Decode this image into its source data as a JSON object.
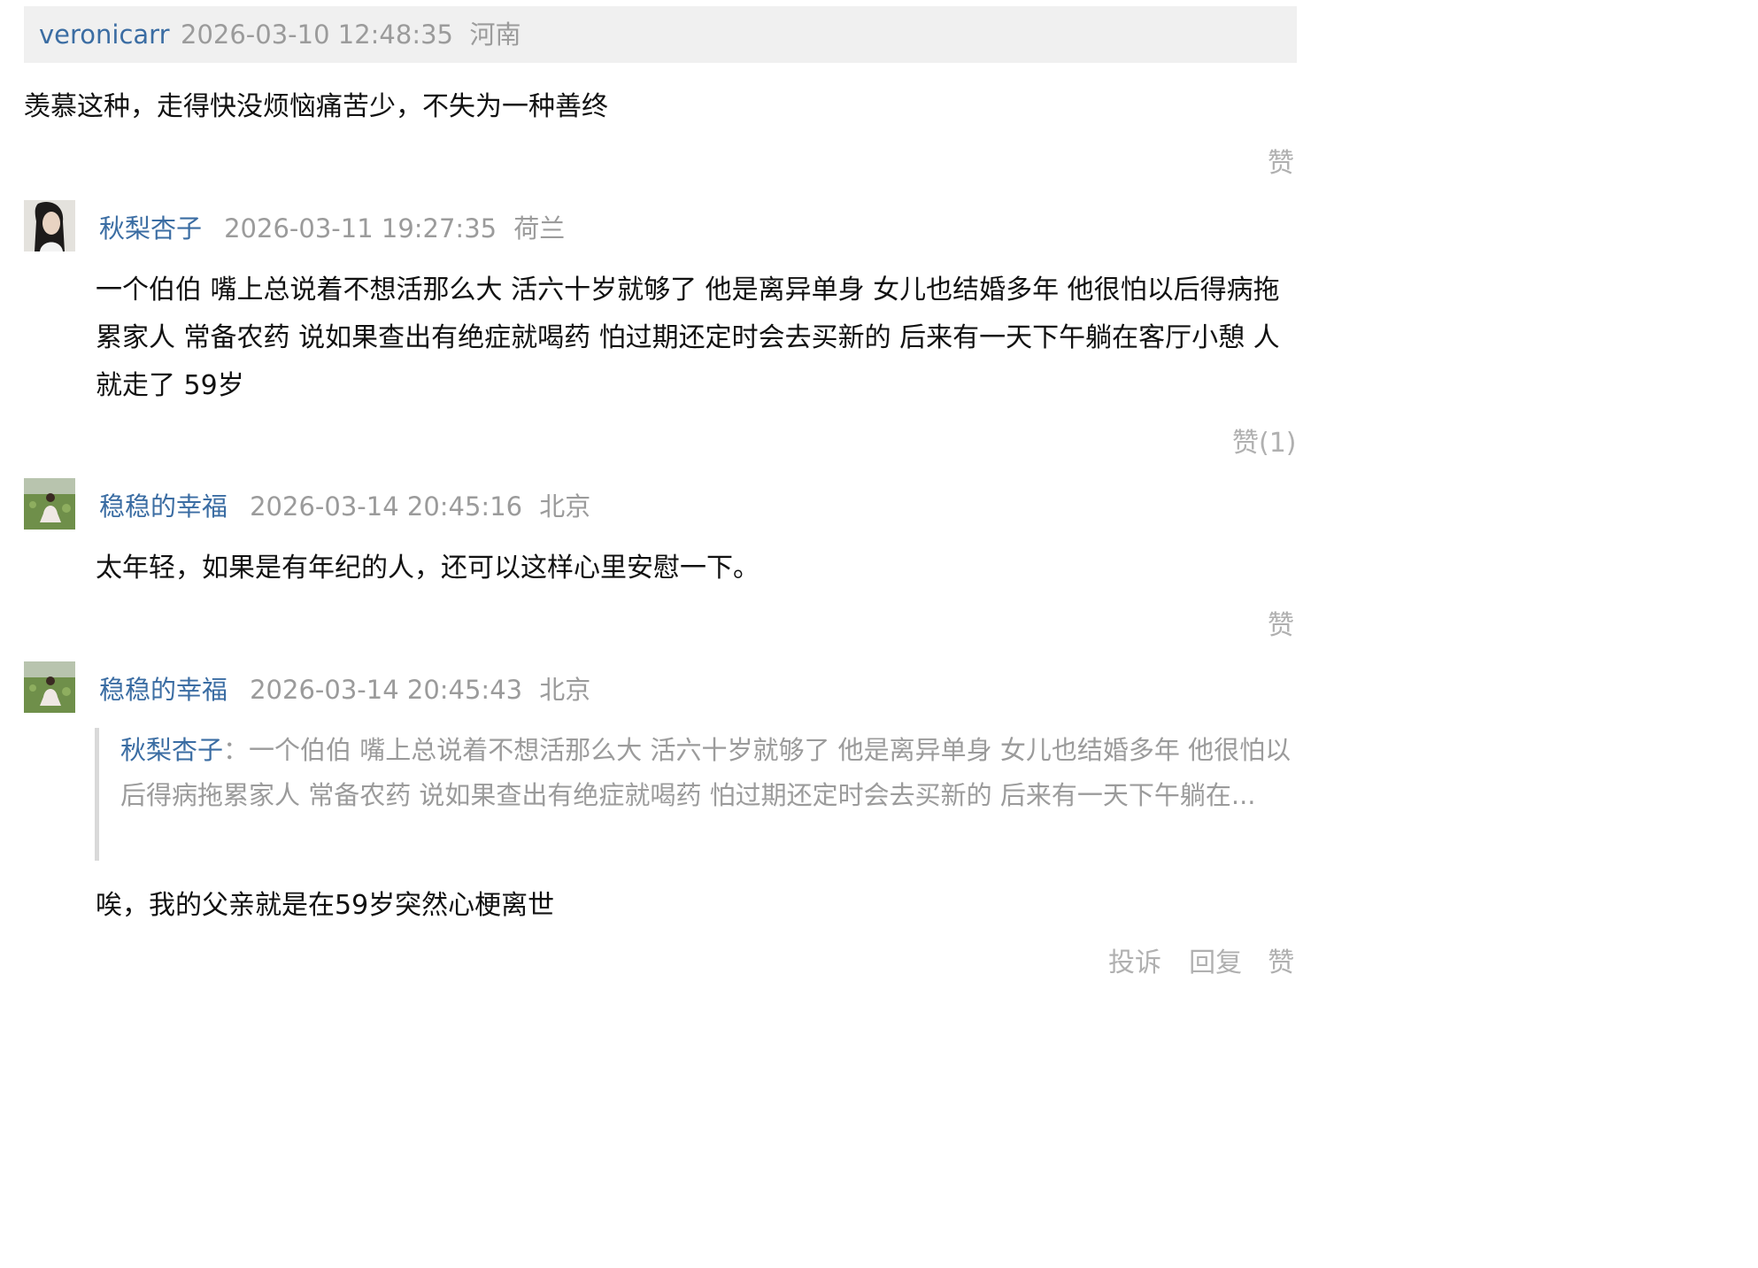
{
  "comments": [
    {
      "username": "veronicarr",
      "datetime": "2026-03-10 12:48:35",
      "location": "河南",
      "text": "羡慕这种，走得快没烦恼痛苦少，不失为一种善终",
      "like_label": "赞"
    },
    {
      "username": "秋梨杏子",
      "datetime": "2026-03-11 19:27:35",
      "location": "荷兰",
      "text": "一个伯伯 嘴上总说着不想活那么大 活六十岁就够了 他是离异单身 女儿也结婚多年 他很怕以后得病拖累家人 常备农药 说如果查出有绝症就喝药 怕过期还定时会去买新的 后来有一天下午躺在客厅小憩 人就走了 59岁",
      "like_label": "赞(1)",
      "avatar_icon": "user-avatar-icon"
    },
    {
      "username": "稳稳的幸福",
      "datetime": "2026-03-14 20:45:16",
      "location": "北京",
      "text": "太年轻，如果是有年纪的人，还可以这样心里安慰一下。",
      "like_label": "赞",
      "avatar_icon": "user-avatar-icon"
    },
    {
      "username": "稳稳的幸福",
      "datetime": "2026-03-14 20:45:43",
      "location": "北京",
      "quote": {
        "author": "秋梨杏子",
        "separator": "：",
        "text": "一个伯伯 嘴上总说着不想活那么大 活六十岁就够了 他是离异单身 女儿也结婚多年 他很怕以后得病拖累家人 常备农药 说如果查出有绝症就喝药 怕过期还定时会去买新的 后来有一天下午躺在..."
      },
      "text": "唉，我的父亲就是在59岁突然心梗离世",
      "report_label": "投诉",
      "reply_label": "回复",
      "like_label": "赞",
      "avatar_icon": "user-avatar-icon"
    }
  ],
  "colors": {
    "link": "#3b6da3",
    "meta": "#9b9b9b",
    "action": "#b0b0b0",
    "header_bg": "#f0f0f0"
  }
}
